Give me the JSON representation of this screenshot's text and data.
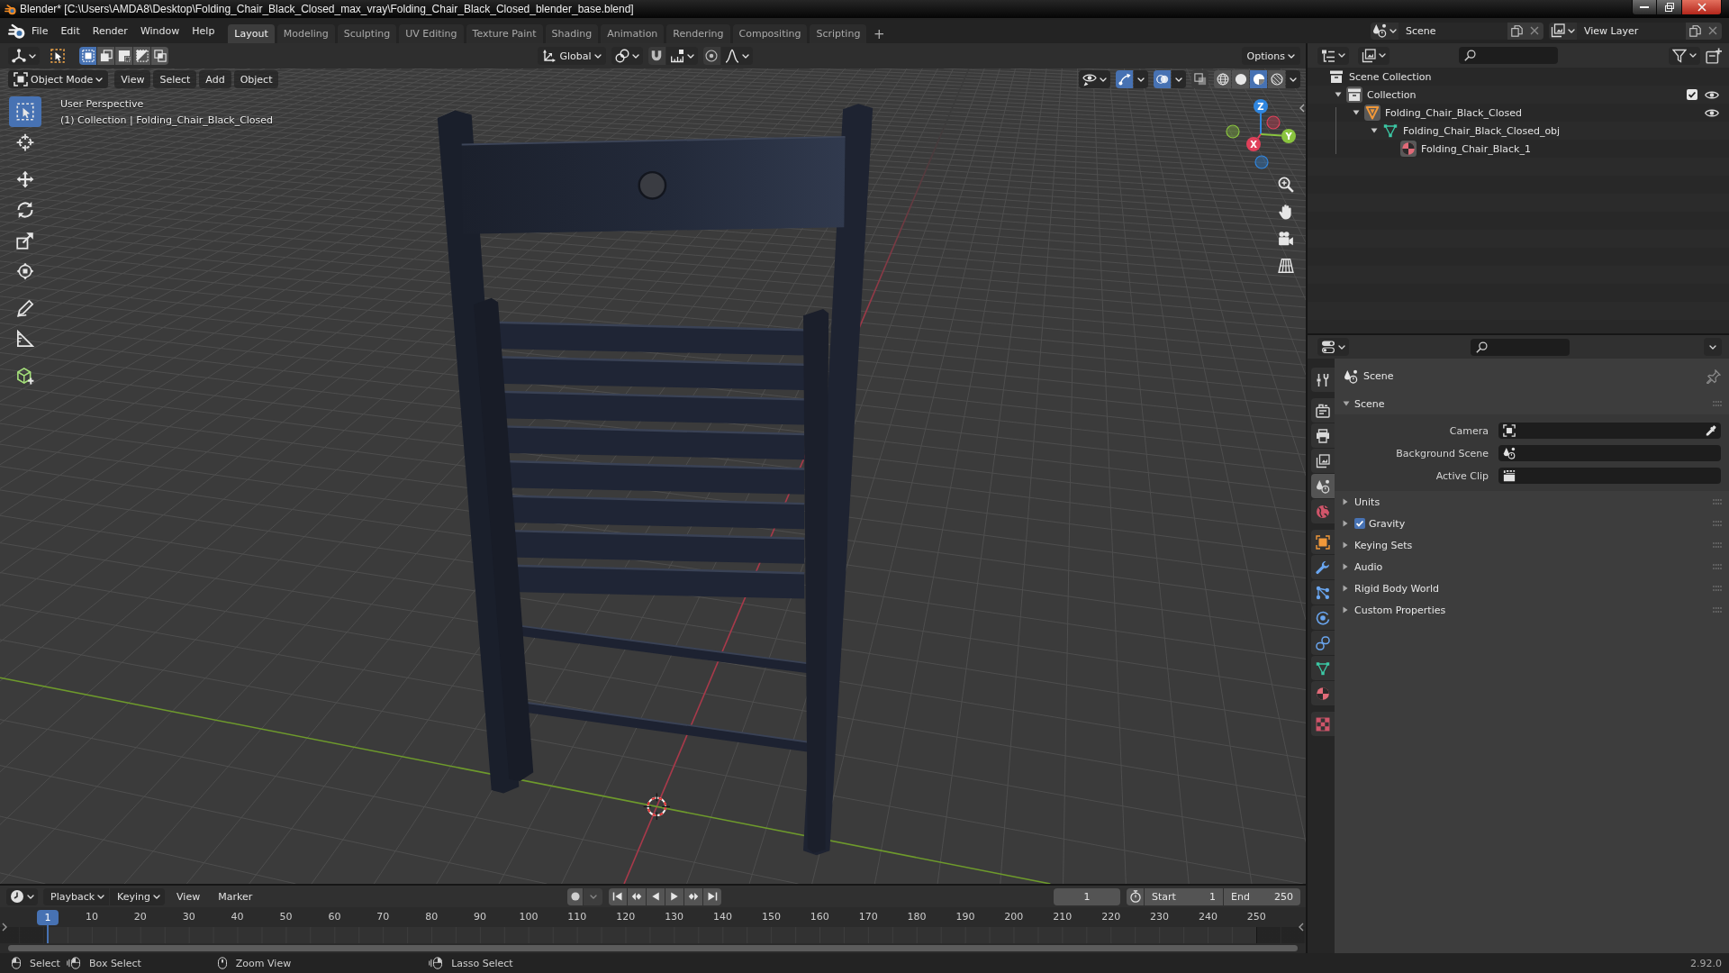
{
  "title_bar": {
    "title": "Blender* [C:\\Users\\AMDA8\\Desktop\\Folding_Chair_Black_Closed_max_vray\\Folding_Chair_Black_Closed_blender_base.blend]"
  },
  "top_bar": {
    "menus": [
      "File",
      "Edit",
      "Render",
      "Window",
      "Help"
    ],
    "workspaces": [
      {
        "label": "Layout",
        "selected": true
      },
      {
        "label": "Modeling",
        "selected": false
      },
      {
        "label": "Sculpting",
        "selected": false
      },
      {
        "label": "UV Editing",
        "selected": false
      },
      {
        "label": "Texture Paint",
        "selected": false
      },
      {
        "label": "Shading",
        "selected": false
      },
      {
        "label": "Animation",
        "selected": false
      },
      {
        "label": "Rendering",
        "selected": false
      },
      {
        "label": "Compositing",
        "selected": false
      },
      {
        "label": "Scripting",
        "selected": false
      }
    ],
    "add_workspace": "+",
    "scene": "Scene",
    "view_layer": "View Layer"
  },
  "viewport": {
    "select_modes": [
      {
        "kind": "set",
        "selected": true
      },
      {
        "kind": "extend",
        "selected": false
      },
      {
        "kind": "subtract",
        "selected": false
      },
      {
        "kind": "invert",
        "selected": false
      },
      {
        "kind": "intersect",
        "selected": false
      }
    ],
    "orientation": "Global",
    "snap": {
      "on": false
    },
    "proportional_editing": {
      "on": false
    },
    "options": "Options",
    "mode": "Object Mode",
    "menus": [
      "View",
      "Select",
      "Add",
      "Object"
    ],
    "toggles": [
      {
        "kind": "gizmos",
        "on": true
      },
      {
        "kind": "overlays",
        "on": true
      },
      {
        "kind": "xray",
        "on": false
      }
    ],
    "shading": [
      {
        "kind": "wireframe",
        "selected": false
      },
      {
        "kind": "solid",
        "selected": false
      },
      {
        "kind": "material",
        "selected": true
      },
      {
        "kind": "rendered",
        "selected": false
      }
    ],
    "info": [
      "User Perspective",
      "(1) Collection | Folding_Chair_Black_Closed"
    ],
    "toolbar": [
      [
        {
          "kind": "select-box",
          "selected": true
        },
        {
          "kind": "cursor",
          "selected": false
        }
      ],
      [
        {
          "kind": "move",
          "selected": false
        },
        {
          "kind": "rotate",
          "selected": false
        },
        {
          "kind": "scale",
          "selected": false
        },
        {
          "kind": "transform",
          "selected": false
        }
      ],
      [
        {
          "kind": "annotate",
          "selected": false
        },
        {
          "kind": "measure",
          "selected": false
        }
      ],
      [
        {
          "kind": "add-cube",
          "selected": false
        }
      ]
    ],
    "navigation_gizmo": [
      {
        "label": "Z",
        "color": "#2f86e0"
      },
      {
        "label": "Y",
        "color": "#8ac43f"
      },
      {
        "label": "X",
        "color": "#e0405a"
      }
    ]
  },
  "outliner": {
    "items": [
      {
        "label": "Scene Collection",
        "kind": "scene-collection",
        "active": false,
        "children": [
          {
            "label": "Collection",
            "kind": "collection",
            "expanded": true,
            "active": true,
            "checked": true,
            "visible": true,
            "children": [
              {
                "label": "Folding_Chair_Black_Closed",
                "kind": "object",
                "expanded": true,
                "active": true,
                "visible": true,
                "children": [
                  {
                    "label": "Folding_Chair_Black_Closed_obj",
                    "kind": "mesh",
                    "expanded": true,
                    "active": false,
                    "children": [
                      {
                        "label": "Folding_Chair_Black_1",
                        "kind": "material",
                        "active": true
                      }
                    ]
                  }
                ]
              }
            ]
          }
        ]
      }
    ]
  },
  "properties": {
    "tabs": [
      [
        {
          "kind": "tool",
          "selected": false
        }
      ],
      [
        {
          "kind": "render",
          "selected": false
        },
        {
          "kind": "output",
          "selected": false
        },
        {
          "kind": "view-layer",
          "selected": false
        },
        {
          "kind": "scene",
          "selected": true
        },
        {
          "kind": "world",
          "selected": false
        }
      ],
      [
        {
          "kind": "object",
          "selected": false
        },
        {
          "kind": "modifiers",
          "selected": false
        },
        {
          "kind": "particles",
          "selected": false
        },
        {
          "kind": "physics",
          "selected": false
        },
        {
          "kind": "constraints",
          "selected": false
        },
        {
          "kind": "data",
          "selected": false
        },
        {
          "kind": "material",
          "selected": false
        }
      ],
      [
        {
          "kind": "texture",
          "selected": false
        }
      ]
    ],
    "context": "Scene",
    "panels": [
      {
        "title": "Scene",
        "kind": "plain",
        "expanded": true,
        "fields": [
          {
            "label": "Camera",
            "kind": "camera"
          },
          {
            "label": "Background Scene",
            "kind": "scene"
          },
          {
            "label": "Active Clip",
            "kind": "clip"
          }
        ]
      },
      {
        "title": "Units",
        "kind": "plain",
        "expanded": false
      },
      {
        "title": "Gravity",
        "kind": "toggle",
        "checked": true,
        "expanded": false
      },
      {
        "title": "Keying Sets",
        "kind": "plain",
        "expanded": false
      },
      {
        "title": "Audio",
        "kind": "plain",
        "expanded": false
      },
      {
        "title": "Rigid Body World",
        "kind": "plain",
        "expanded": false
      },
      {
        "title": "Custom Properties",
        "kind": "plain",
        "expanded": false
      }
    ]
  },
  "timeline": {
    "menus": [
      {
        "label": "Playback",
        "kind": "dropdown"
      },
      {
        "label": "Keying",
        "kind": "dropdown"
      },
      {
        "label": "View",
        "kind": "menu"
      },
      {
        "label": "Marker",
        "kind": "menu"
      }
    ],
    "auto_keying": {
      "on": false
    },
    "current_frame": "1",
    "preview_range": {
      "on": false
    },
    "range": [
      {
        "label": "Start",
        "value": "1"
      },
      {
        "label": "End",
        "value": "250"
      }
    ],
    "playhead": "1",
    "ruler": [
      "10",
      "20",
      "30",
      "40",
      "50",
      "60",
      "70",
      "80",
      "90",
      "100",
      "110",
      "120",
      "130",
      "140",
      "150",
      "160",
      "170",
      "180",
      "190",
      "200",
      "210",
      "220",
      "230",
      "240",
      "250"
    ]
  },
  "status_bar": {
    "hints": [
      {
        "kind": "left-click",
        "label": "Select"
      },
      {
        "kind": "left-drag",
        "label": "Box Select"
      },
      {
        "kind": "middle-click",
        "label": "Zoom View"
      },
      {
        "kind": "right-drag",
        "label": "Lasso Select"
      }
    ],
    "version": "2.92.0"
  }
}
